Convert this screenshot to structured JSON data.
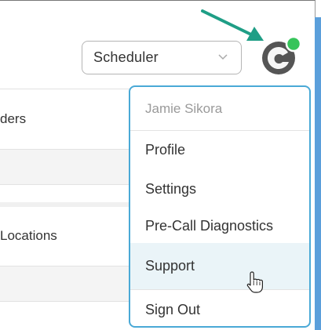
{
  "header": {
    "role_select": {
      "value": "Scheduler"
    }
  },
  "background": {
    "section_1_label": "ders",
    "section_2_label": "Locations"
  },
  "user_menu": {
    "user_name": "Jamie Sikora",
    "items": [
      {
        "label": "Profile"
      },
      {
        "label": "Settings"
      },
      {
        "label": "Pre-Call Diagnostics"
      },
      {
        "label": "Support"
      },
      {
        "label": "Sign Out"
      }
    ],
    "hovered_item": "Support"
  },
  "colors": {
    "accent_border": "#4aa9d6",
    "hover_bg": "#eaf4f8",
    "status_dot": "#36c45a",
    "avatar": "#555555",
    "arrow": "#1f9e86"
  },
  "icons": {
    "avatar": "user-avatar-logo",
    "status": "online-status-dot",
    "chevron": "chevron-down-icon",
    "cursor": "hand-pointer-cursor",
    "annotation": "teal-arrow-annotation"
  }
}
